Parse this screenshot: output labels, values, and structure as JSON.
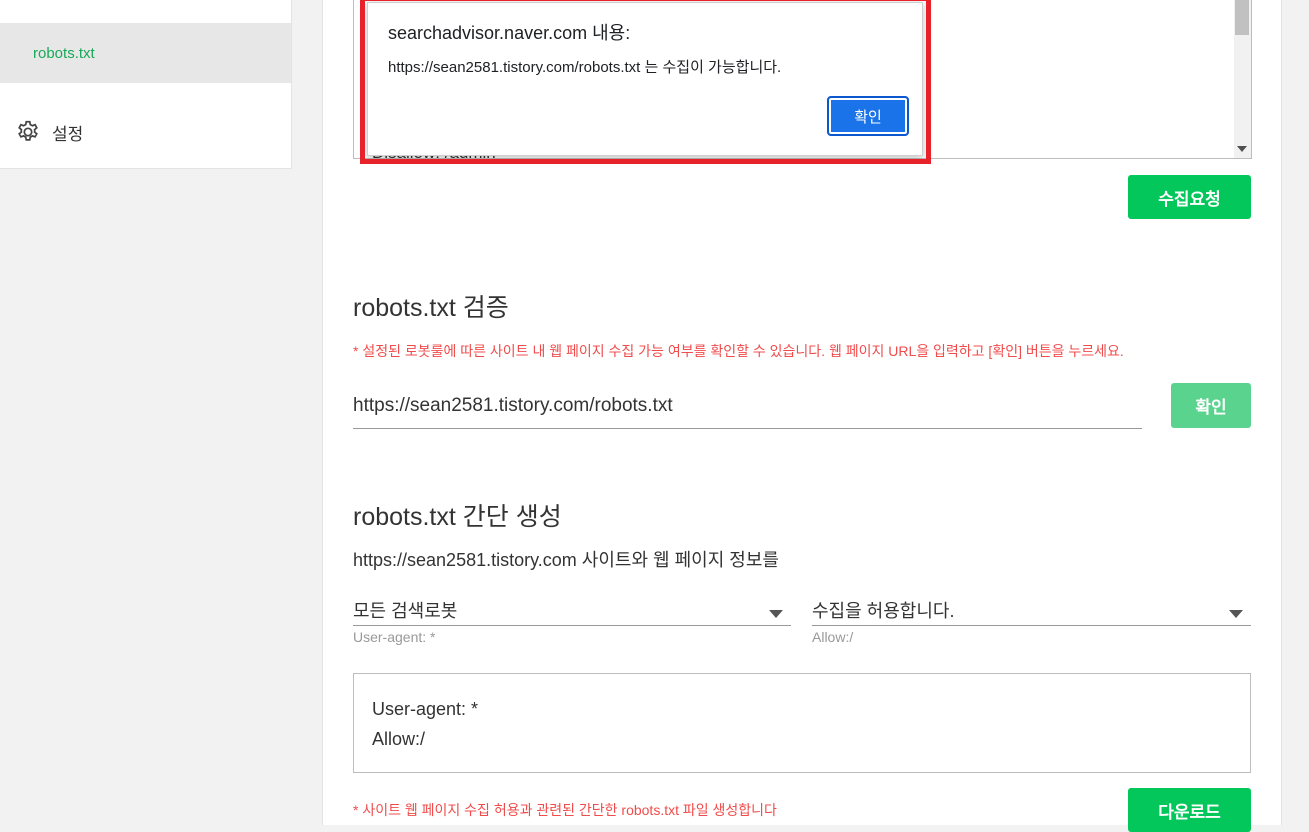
{
  "sidebar": {
    "active_item_label": "robots.txt",
    "settings_label": "설정",
    "settings_icon": "gear-icon"
  },
  "editor": {
    "peek_text": "Disallow: /admin"
  },
  "buttons": {
    "collect_request": "수집요청",
    "verify": "확인",
    "download": "다운로드"
  },
  "verify_section": {
    "title": "robots.txt 검증",
    "note": "* 설정된 로봇룰에 따른 사이트 내 웹 페이지 수집 가능 여부를 확인할 수 있습니다. 웹 페이지 URL을 입력하고 [확인] 버튼을 누르세요.",
    "url_value": "https://sean2581.tistory.com/robots.txt"
  },
  "generate_section": {
    "title": "robots.txt 간단 생성",
    "site_text": "https://sean2581.tistory.com 사이트와 웹 페이지 정보를",
    "agent_select": "모든 검색로봇",
    "agent_sub": "User-agent: *",
    "allow_select": "수집을 허용합니다.",
    "allow_sub": "Allow:/",
    "output_line1": "User-agent: *",
    "output_line2": "Allow:/",
    "note": "* 사이트 웹 페이지 수집 허용과 관련된 간단한 robots.txt 파일 생성합니다"
  },
  "alert": {
    "title": "searchadvisor.naver.com 내용:",
    "message": "https://sean2581.tistory.com/robots.txt 는 수집이 가능합니다.",
    "ok_label": "확인"
  },
  "colors": {
    "accent_green": "#03c75a",
    "highlight_red": "#e8222a",
    "note_red": "#f04c4c",
    "dialog_blue": "#1a73e8"
  }
}
